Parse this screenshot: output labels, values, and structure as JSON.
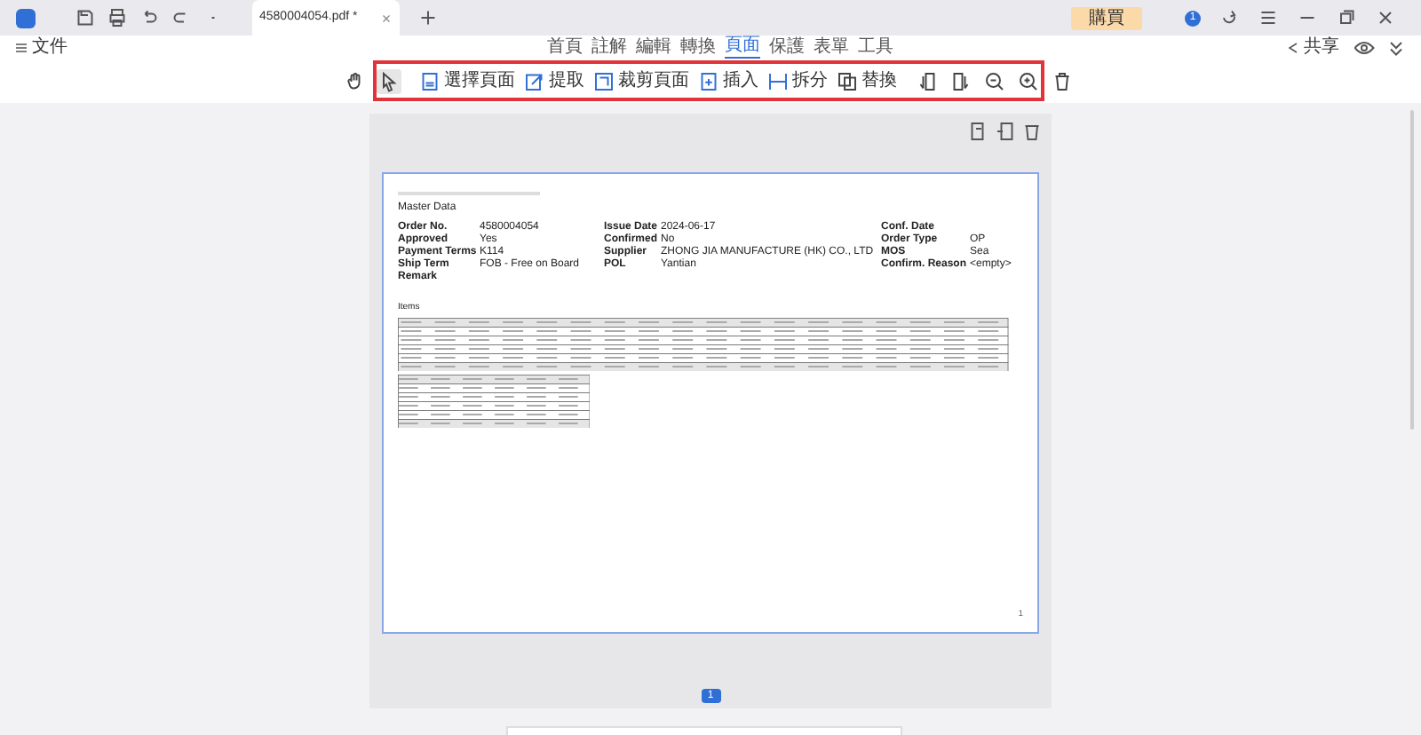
{
  "tab": {
    "title": "4580004054.pdf *"
  },
  "buy_button": "購買",
  "notification_count": "1",
  "file_menu": "文件",
  "ribbon_tabs": [
    {
      "label": "首頁",
      "selected": false
    },
    {
      "label": "註解",
      "selected": false
    },
    {
      "label": "編輯",
      "selected": false
    },
    {
      "label": "轉換",
      "selected": false
    },
    {
      "label": "頁面",
      "selected": true
    },
    {
      "label": "保護",
      "selected": false
    },
    {
      "label": "表單",
      "selected": false
    },
    {
      "label": "工具",
      "selected": false
    }
  ],
  "share": "共享",
  "toolbar": [
    {
      "kind": "icon",
      "selected": false
    },
    {
      "kind": "icon",
      "selected": true
    },
    {
      "kind": "sep"
    },
    {
      "kind": "labeled",
      "label": "選擇頁面"
    },
    {
      "kind": "labeled",
      "label": "提取"
    },
    {
      "kind": "labeled",
      "label": "裁剪頁面"
    },
    {
      "kind": "labeled",
      "label": "插入"
    },
    {
      "kind": "labeled",
      "label": "拆分"
    },
    {
      "kind": "labeled",
      "label": "替換"
    },
    {
      "kind": "sep"
    },
    {
      "kind": "icon",
      "selected": false
    },
    {
      "kind": "icon",
      "selected": false
    },
    {
      "kind": "icon",
      "selected": false
    },
    {
      "kind": "icon",
      "selected": false
    },
    {
      "kind": "icon",
      "selected": false
    }
  ],
  "document": {
    "section_title": "Master Data",
    "fields": [
      {
        "label": "Order No.",
        "value": "4580004054"
      },
      {
        "label": "Issue Date",
        "value": "2024-06-17"
      },
      {
        "label": "Conf. Date"
      },
      {
        "label": "Approved",
        "value": "Yes"
      },
      {
        "label": "Confirmed",
        "value": "No"
      },
      {
        "label": "Order Type",
        "value": "OP"
      },
      {
        "label": "Payment Terms",
        "value": "K114"
      },
      {
        "label": "Supplier",
        "value": "ZHONG JIA MANUFACTURE (HK) CO., LTD"
      },
      {
        "label": "MOS",
        "value": "Sea"
      },
      {
        "label": "Ship Term",
        "value": "FOB - Free on Board"
      },
      {
        "label": "POL",
        "value": "Yantian"
      },
      {
        "label": "Confirm. Reason",
        "value": "<empty>"
      },
      {
        "label": "Remark"
      }
    ],
    "items_title": "Items",
    "page_number": "1"
  },
  "page_indicator": "1"
}
